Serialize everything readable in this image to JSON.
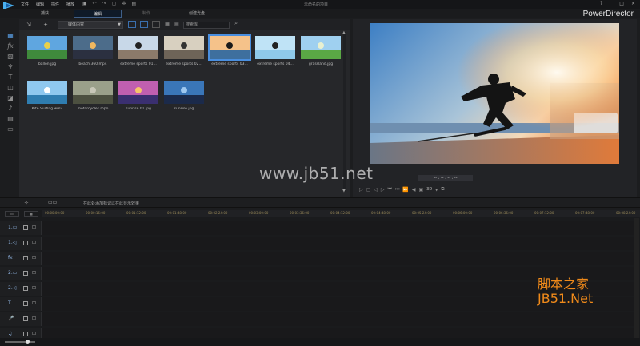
{
  "menu": [
    "文件",
    "编辑",
    "插件",
    "播放"
  ],
  "project_title": "未命名的项目",
  "window_controls": [
    "?",
    "_",
    "□",
    "×"
  ],
  "mode_tabs": [
    {
      "label": "捕获",
      "active": false
    },
    {
      "label": "编辑",
      "active": true
    },
    {
      "label": "制作",
      "active": false
    },
    {
      "label": "创建光盘",
      "active": false
    }
  ],
  "brand": "PowerDirector",
  "library": {
    "filter_label": "媒体内容",
    "search_placeholder": "搜索库",
    "thumbnails": [
      {
        "caption": "ballon.jpg",
        "sky": "#5fa6e0",
        "ground": "#3f8a3c",
        "accent": "#e9d04a"
      },
      {
        "caption": "beach 360.mp4",
        "sky": "#4c6c8a",
        "ground": "#2b3040",
        "accent": "#f0b860"
      },
      {
        "caption": "extreme sports 01...",
        "sky": "#c8d8e8",
        "ground": "#8b7a6a",
        "accent": "#222222"
      },
      {
        "caption": "extreme sports 02...",
        "sky": "#d8d0c0",
        "ground": "#6e6458",
        "accent": "#333333"
      },
      {
        "caption": "extreme sports 03...",
        "sky": "#f5c28a",
        "ground": "#3e6f9e",
        "accent": "#1a1a1a"
      },
      {
        "caption": "extreme sports 04...",
        "sky": "#bfe3f6",
        "ground": "#8fc9ea",
        "accent": "#222222"
      },
      {
        "caption": "grassland.jpg",
        "sky": "#9fd0f0",
        "ground": "#5aa845",
        "accent": "#e8f0d0"
      },
      {
        "caption": "Kite Surfing.wmv",
        "sky": "#8fc8ef",
        "ground": "#2f7db0",
        "accent": "#ffffff"
      },
      {
        "caption": "motorcycles.mpo",
        "sky": "#9aa08a",
        "ground": "#4c5040",
        "accent": "#c8c8b8"
      },
      {
        "caption": "sunrise 01.jpg",
        "sky": "#c05fb0",
        "ground": "#3a2f70",
        "accent": "#f6c46a"
      },
      {
        "caption": "sunrise.jpg",
        "sky": "#3a76b8",
        "ground": "#1b2a4a",
        "accent": "#9ec8f0"
      }
    ]
  },
  "preview": {
    "timecode": "-- : -- : -- : --",
    "mode_3d": "3D"
  },
  "mid_hint": "在此处添加标记以在此显示效果",
  "timeline": {
    "ruler_ticks": [
      "00:00:00:00",
      "00:00:16:00",
      "00:01:12:00",
      "00:01:48:00",
      "00:02:24:00",
      "00:03:00:00",
      "00:03:36:00",
      "00:04:12:00",
      "00:04:48:00",
      "00:05:24:00",
      "00:06:00:00",
      "00:06:36:00",
      "00:07:12:00",
      "00:07:48:00",
      "00:08:24:00"
    ],
    "tracks": [
      {
        "icon": "1.▭",
        "kind": "video"
      },
      {
        "icon": "1.◁",
        "kind": "audio"
      },
      {
        "icon": "fx",
        "kind": "effect"
      },
      {
        "icon": "2.▭",
        "kind": "video"
      },
      {
        "icon": "2.◁",
        "kind": "audio"
      },
      {
        "icon": "T",
        "kind": "title"
      },
      {
        "icon": "🎤",
        "kind": "voice"
      },
      {
        "icon": "♫",
        "kind": "music"
      }
    ]
  },
  "watermarks": {
    "center": "www.jb51.net",
    "cn": "脚本之家",
    "en": "JB51.Net"
  }
}
